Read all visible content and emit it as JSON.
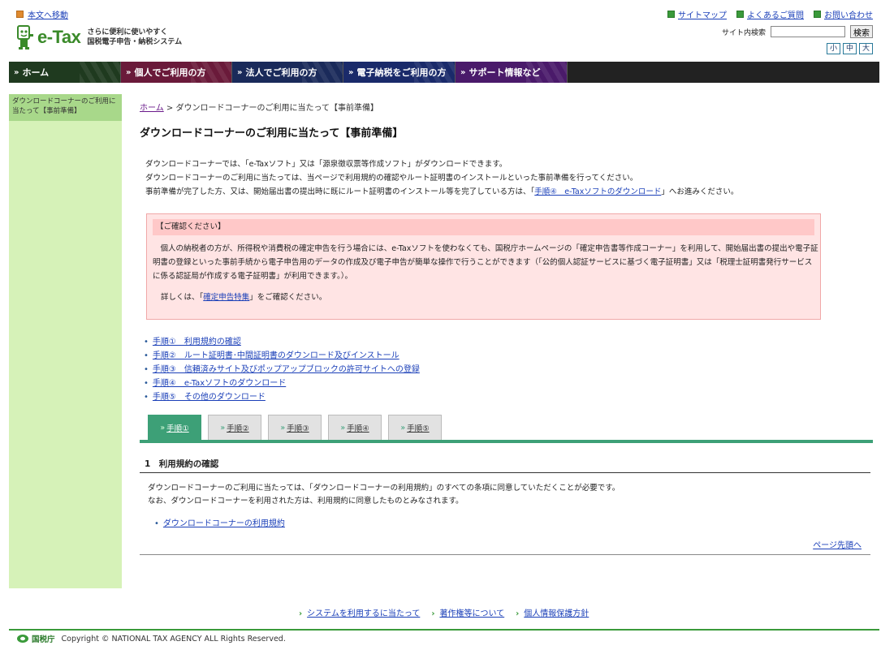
{
  "header": {
    "skip_link": "本文へ移動",
    "top_links": [
      "サイトマップ",
      "よくあるご質問",
      "お問い合わせ"
    ],
    "logo_text": "e-Tax",
    "logo_sub_1": "さらに便利に使いやすく",
    "logo_sub_2": "国税電子申告・納税システム",
    "search_label": "サイト内検索",
    "search_button": "検索",
    "font_sizes": [
      "小",
      "中",
      "大"
    ]
  },
  "nav": {
    "home": "ホーム",
    "tabs": [
      "個人でご利用の方",
      "法人でご利用の方",
      "電子納税をご利用の方",
      "サポート情報など"
    ]
  },
  "sidebar": {
    "current": "ダウンロードコーナーのご利用に当たって【事前準備】"
  },
  "main": {
    "breadcrumb_home": "ホーム",
    "breadcrumb_sep": ">",
    "breadcrumb_current": "ダウンロードコーナーのご利用に当たって【事前準備】",
    "title": "ダウンロードコーナーのご利用に当たって【事前準備】",
    "intro_1": "ダウンロードコーナーでは、「e-Taxソフト」又は「源泉徴収票等作成ソフト」がダウンロードできます。",
    "intro_2": "ダウンロードコーナーのご利用に当たっては、当ページで利用規約の確認やルート証明書のインストールといった事前準備を行ってください。",
    "intro_3a": "事前準備が完了した方、又は、開始届出書の提出時に既にルート証明書のインストール等を完了している方は、「",
    "intro_3_link": "手順④　e-Taxソフトのダウンロード",
    "intro_3b": "」へお進みください。",
    "notice_head": "【ご確認ください】",
    "notice_body": "個人の納税者の方が、所得税や消費税の確定申告を行う場合には、e-Taxソフトを使わなくても、国税庁ホームページの「確定申告書等作成コーナー」を利用して、開始届出書の提出や電子証明書の登録といった事前手続から電子申告用のデータの作成及び電子申告が簡単な操作で行うことができます（「公的個人認証サービスに基づく電子証明書」又は「税理士証明書発行サービスに係る認証局が作成する電子証明書」が利用できます。）。",
    "notice_detail_a": "詳しくは、「",
    "notice_detail_link": "確定申告特集",
    "notice_detail_b": "」をご確認ください。",
    "steps": [
      "手順①　利用規約の確認",
      "手順②　ルート証明書･中間証明書のダウンロード及びインストール",
      "手順③　信頼済みサイト及びポップアップブロックの許可サイトへの登録",
      "手順④　e-Taxソフトのダウンロード",
      "手順⑤　その他のダウンロード"
    ],
    "step_tabs": [
      "手順①",
      "手順②",
      "手順③",
      "手順④",
      "手順⑤"
    ],
    "section_title": "1　利用規約の確認",
    "section_body_1": "ダウンロードコーナーのご利用に当たっては、「ダウンロードコーナーの利用規約」のすべての条項に同意していただくことが必要です。",
    "section_body_2": "なお、ダウンロードコーナーを利用された方は、利用規約に同意したものとみなされます。",
    "section_link": "ダウンロードコーナーの利用規約",
    "page_top": "ページ先頭へ"
  },
  "footer": {
    "links": [
      "システムを利用するに当たって",
      "著作権等について",
      "個人情報保護方針"
    ],
    "agency": "国税庁",
    "copyright": "Copyright © NATIONAL TAX AGENCY ALL Rights Reserved."
  }
}
